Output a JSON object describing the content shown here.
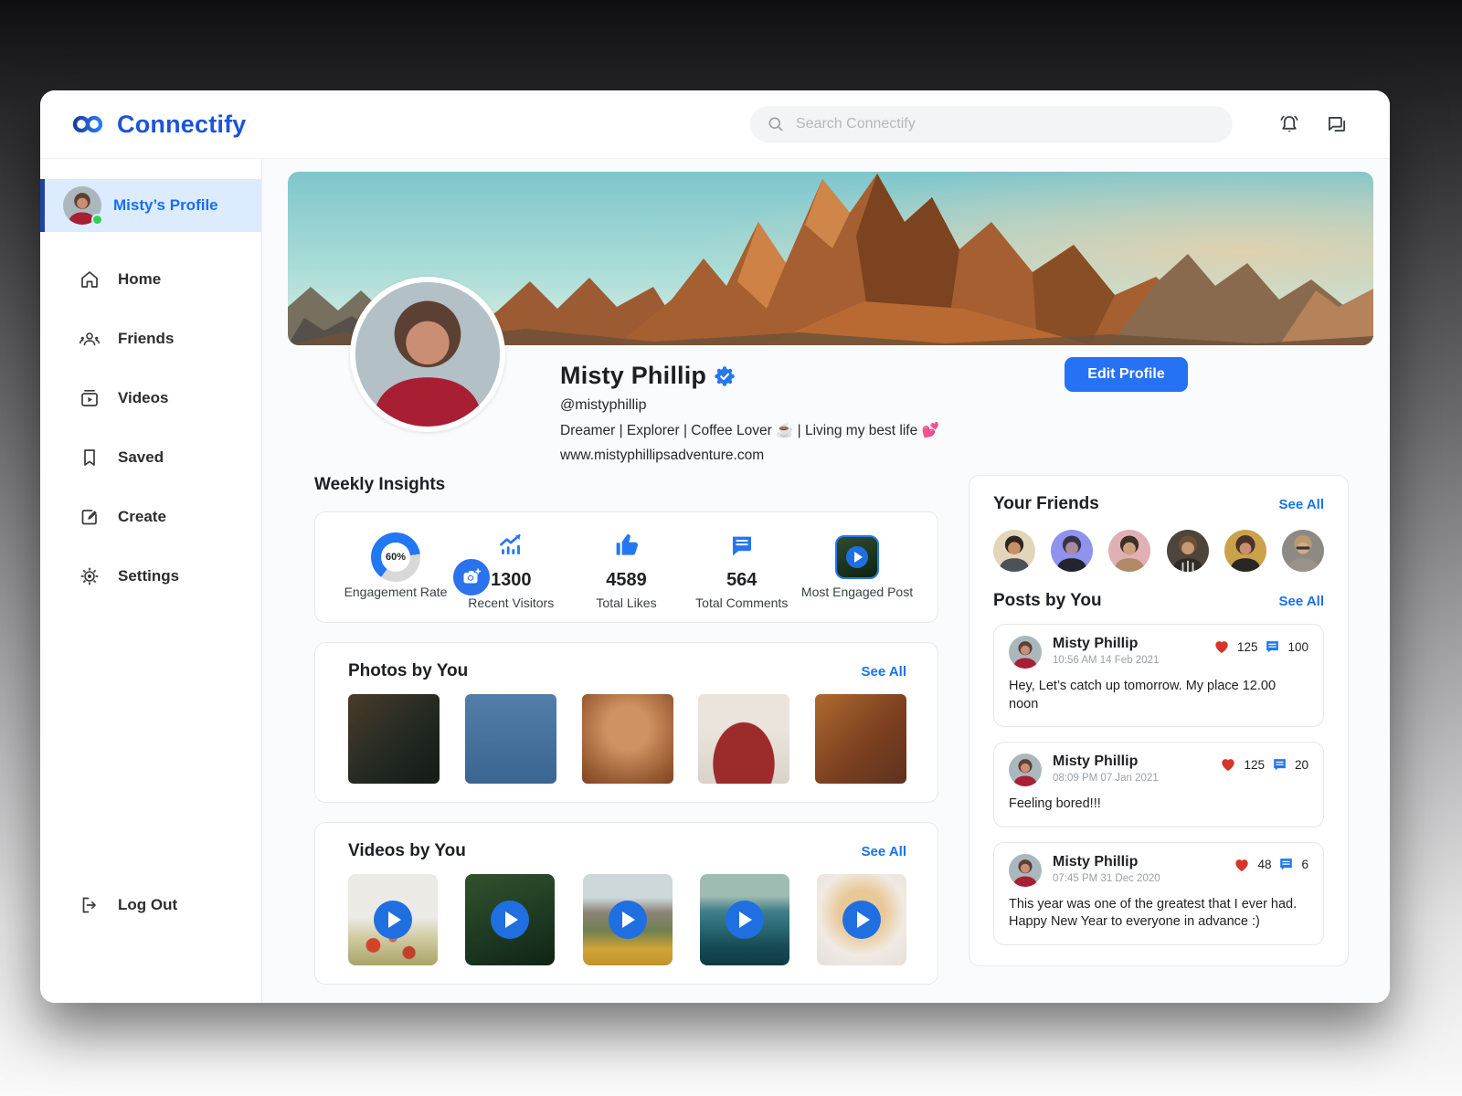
{
  "header": {
    "brand": "Connectify",
    "search_placeholder": "Search Connectify"
  },
  "sidebar": {
    "profile_item": {
      "label": "Misty’s Profile"
    },
    "items": [
      {
        "label": "Home",
        "icon": "home-icon"
      },
      {
        "label": "Friends",
        "icon": "friends-icon"
      },
      {
        "label": "Videos",
        "icon": "videos-icon"
      },
      {
        "label": "Saved",
        "icon": "bookmark-icon"
      },
      {
        "label": "Create",
        "icon": "create-icon"
      },
      {
        "label": "Settings",
        "icon": "gear-icon"
      }
    ],
    "logout_label": "Log Out"
  },
  "profile": {
    "name": "Misty Phillip",
    "verified": true,
    "handle": "@mistyphillip",
    "bio": "Dreamer | Explorer | Coffee Lover ☕ | Living my best life 💕",
    "website": "www.mistyphillipsadventure.com",
    "edit_button": "Edit Profile"
  },
  "insights": {
    "title": "Weekly Insights",
    "engagement_pct": 60,
    "stats": [
      {
        "value": "60%",
        "label": "Engagement Rate",
        "icon": "donut-chart-icon"
      },
      {
        "value": "1300",
        "label": "Recent Visitors",
        "icon": "analytics-icon"
      },
      {
        "value": "4589",
        "label": "Total Likes",
        "icon": "thumb-up-icon"
      },
      {
        "value": "564",
        "label": "Total Comments",
        "icon": "comment-icon"
      },
      {
        "value": "",
        "label": "Most Engaged Post",
        "icon": "video-play-icon"
      }
    ]
  },
  "photos_section": {
    "title": "Photos by You",
    "see_all": "See All",
    "photo_count": 5
  },
  "videos_section": {
    "title": "Videos by You",
    "see_all": "See All",
    "video_count": 5
  },
  "friends_section": {
    "title": "Your Friends",
    "see_all": "See All",
    "friend_count": 6
  },
  "posts_section": {
    "title": "Posts by You",
    "see_all": "See All",
    "posts": [
      {
        "author": "Misty Phillip",
        "timestamp": "10:56 AM 14 Feb 2021",
        "likes": "125",
        "comments": "100",
        "text": "Hey, Let’s catch up tomorrow. My place 12.00 noon"
      },
      {
        "author": "Misty Phillip",
        "timestamp": "08:09 PM 07 Jan 2021",
        "likes": "125",
        "comments": "20",
        "text": "Feeling bored!!!"
      },
      {
        "author": "Misty Phillip",
        "timestamp": "07:45 PM 31 Dec 2020",
        "likes": "48",
        "comments": "6",
        "text": "This year was one of the greatest that I ever had. Happy New Year to everyone in advance :)"
      }
    ]
  },
  "colors": {
    "primary_blue": "#2573f4",
    "link_blue": "#1a73e8",
    "active_item_bg": "#dcebfd",
    "heart_red": "#d7342a",
    "online_green": "#2fd14f"
  }
}
